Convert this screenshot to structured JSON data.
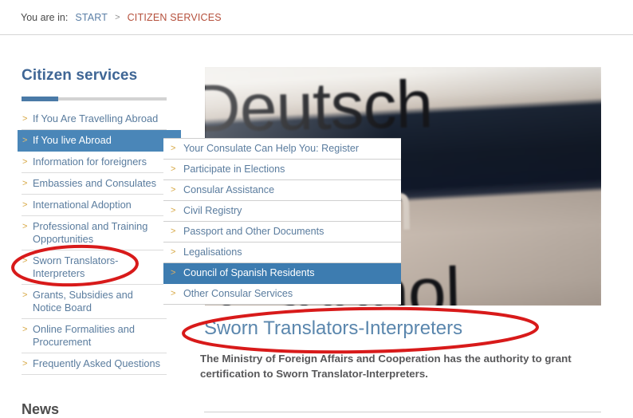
{
  "breadcrumb": {
    "label": "You are in:",
    "home": "START",
    "separator": ">",
    "current": "CITIZEN SERVICES"
  },
  "sidebar": {
    "title": "Citizen services",
    "chevron": ">",
    "items": [
      {
        "label": "If You Are Travelling Abroad",
        "active": false
      },
      {
        "label": "If You live Abroad",
        "active": true
      },
      {
        "label": "Information for foreigners",
        "active": false
      },
      {
        "label": "Embassies and Consulates",
        "active": false
      },
      {
        "label": "International Adoption",
        "active": false
      },
      {
        "label": "Professional and Training Opportunities",
        "active": false
      },
      {
        "label": "Sworn Translators-Interpreters",
        "active": false
      },
      {
        "label": "Grants, Subsidies and Notice Board",
        "active": false
      },
      {
        "label": "Online Formalities and Procurement",
        "active": false
      },
      {
        "label": "Frequently Asked Questions",
        "active": false
      }
    ]
  },
  "submenu": {
    "chevron": ">",
    "items": [
      {
        "label": "Your Consulate Can Help You: Register",
        "active": false
      },
      {
        "label": "Participate in Elections",
        "active": false
      },
      {
        "label": "Consular Assistance",
        "active": false
      },
      {
        "label": "Civil Registry",
        "active": false
      },
      {
        "label": "Passport and Other Documents",
        "active": false
      },
      {
        "label": "Legalisations",
        "active": false
      },
      {
        "label": "Council of Spanish Residents",
        "active": true
      },
      {
        "label": "Other Consular Services",
        "active": false
      }
    ]
  },
  "banner": {
    "alt": "embassy-sign-photo",
    "sign_text_top": "Deutsch",
    "sign_text_bottom": "Espanol",
    "sign_glyph_middle": "n"
  },
  "content": {
    "heading": "Sworn Translators-Interpreters",
    "paragraph": "The Ministry of Foreign Affairs and Cooperation has the authority to grant certification to Sworn Translator-Interpreters."
  },
  "news": {
    "heading": "News"
  },
  "annotations": {
    "color": "#d81a1a",
    "ellipse_sidebar_target": "Sworn Translators-Interpreters",
    "ellipse_heading_target": "Sworn Translators-Interpreters"
  }
}
